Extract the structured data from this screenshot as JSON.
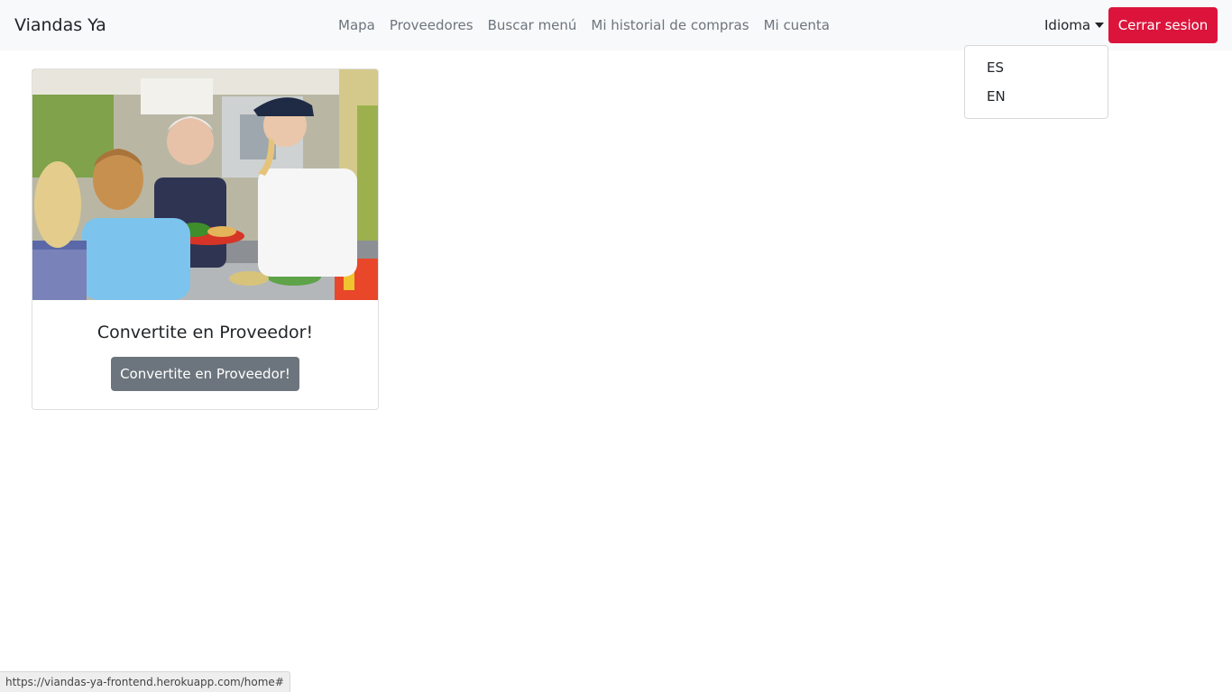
{
  "navbar": {
    "brand": "Viandas Ya",
    "links": [
      "Mapa",
      "Proveedores",
      "Buscar menú",
      "Mi historial de compras",
      "Mi cuenta"
    ],
    "language_toggle": "Idioma",
    "logout_label": "Cerrar sesion",
    "logout_color": "#dc143c"
  },
  "language_menu": {
    "items": [
      "ES",
      "EN"
    ]
  },
  "card": {
    "image_description_icon": "cafeteria-serving-photo",
    "title": "Convertite en Proveedor!",
    "button_label": "Convertite en Proveedor!"
  },
  "status_bar": {
    "url": "https://viandas-ya-frontend.herokuapp.com/home#"
  }
}
